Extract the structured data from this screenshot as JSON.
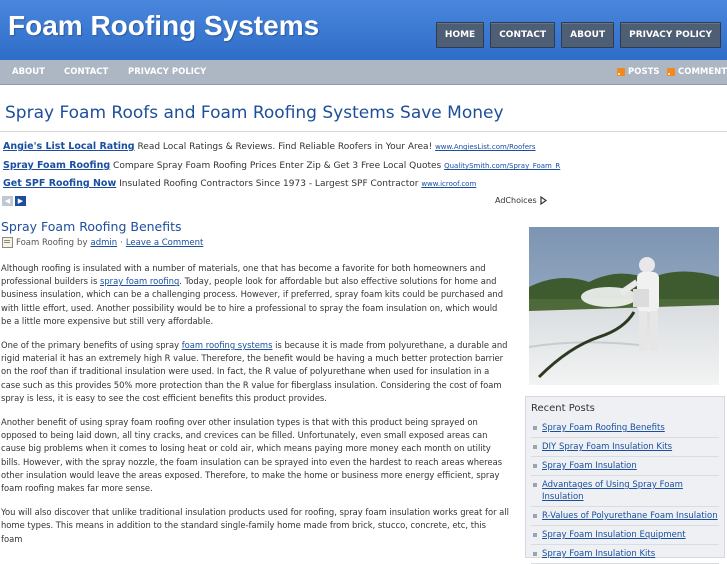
{
  "header": {
    "site_title": "Foam Roofing Systems",
    "nav": [
      "HOME",
      "CONTACT",
      "ABOUT",
      "PRIVACY POLICY"
    ]
  },
  "subnav": {
    "items": [
      "ABOUT",
      "CONTACT",
      "PRIVACY POLICY"
    ],
    "posts_feed": "POSTS",
    "comments_feed": "COMMENTS"
  },
  "page_heading": "Spray Foam Roofs and Foam Roofing Systems Save Money",
  "ads": [
    {
      "title": "Angie's List Local Rating",
      "text": "Read Local Ratings & Reviews. Find Reliable Roofers in Your Area!",
      "url": "www.AngiesList.com/Roofers"
    },
    {
      "title": "Spray Foam Roofing",
      "text": "Compare Spray Foam Roofing Prices Enter Zip & Get 3 Free Local Quotes",
      "url": "QualitySmith.com/Spray_Foam_R"
    },
    {
      "title": "Get SPF Roofing Now",
      "text": "Insulated Roofing Contractors Since 1973 - Largest SPF Contractor",
      "url": "www.icroof.com"
    }
  ],
  "adchoices": "AdChoices",
  "post": {
    "title": "Spray Foam Roofing Benefits",
    "category": "Foam Roofing",
    "by": "by",
    "author": "admin",
    "separator": "·",
    "comment_link": "Leave a Comment",
    "p1_a": "Although roofing is insulated with a number of materials, one that has become a favorite for both homeowners and professional builders is ",
    "p1_link": "spray foam roofing",
    "p1_b": ".  Today, people look for affordable but also effective solutions for home and business insulation, which can be a challenging process.  However, if preferred, spray foam kits could be purchased and with little effort, used.  Another possibility would be to hire a professional to spray the foam insulation on, which would be a little more expensive but still very affordable.",
    "p2_a": "One of the primary benefits of using spray ",
    "p2_link": "foam roofing systems",
    "p2_b": " is because it is made from polyurethane, a durable and rigid material it has an extremely high R value.  Therefore, the benefit would be having a much better protection barrier on the roof than if traditional insulation were used.  In fact, the R value of polyurethane when used for insulation in a case such as this provides 50% more protection than the R value for fiberglass insulation.  Considering the cost of foam spray is less, it is easy to see the cost efficient benefits this product provides.",
    "p3": "Another benefit of using spray foam roofing over other insulation types is that with this product being sprayed on opposed to being laid down, all tiny cracks, and crevices can be filled.  Unfortunately, even small exposed areas can cause big problems when it comes to losing heat or cold air, which means paying more money each month on utility bills.  However, with the spray nozzle, the foam insulation can be sprayed into even the hardest to reach areas whereas other insulation would leave the areas exposed.  Therefore, to make the home or business more energy efficient, spray foam roofing makes far more sense.",
    "p4": "You will also discover that unlike traditional insulation products used for roofing, spray foam insulation works great for all home types.  This means in addition to the standard single-family home made from brick, stucco, concrete, etc, this foam"
  },
  "sidebar": {
    "recent_title": "Recent Posts",
    "recent_posts": [
      "Spray Foam Roofing Benefits",
      "DIY Spray Foam Insulation Kits",
      "Spray Foam Insulation",
      "Advantages of Using Spray Foam Insulation",
      "R-Values of Polyurethane Foam Insulation",
      "Spray Foam Insulation Equipment",
      "Spray Foam Insulation Kits"
    ]
  },
  "colors": {
    "header_blue": "#3a78d2",
    "link_blue": "#1a4fa0",
    "nav_button": "#4e5e74",
    "subnav_gray": "#adb6c3",
    "rss_orange": "#f28a1b"
  }
}
